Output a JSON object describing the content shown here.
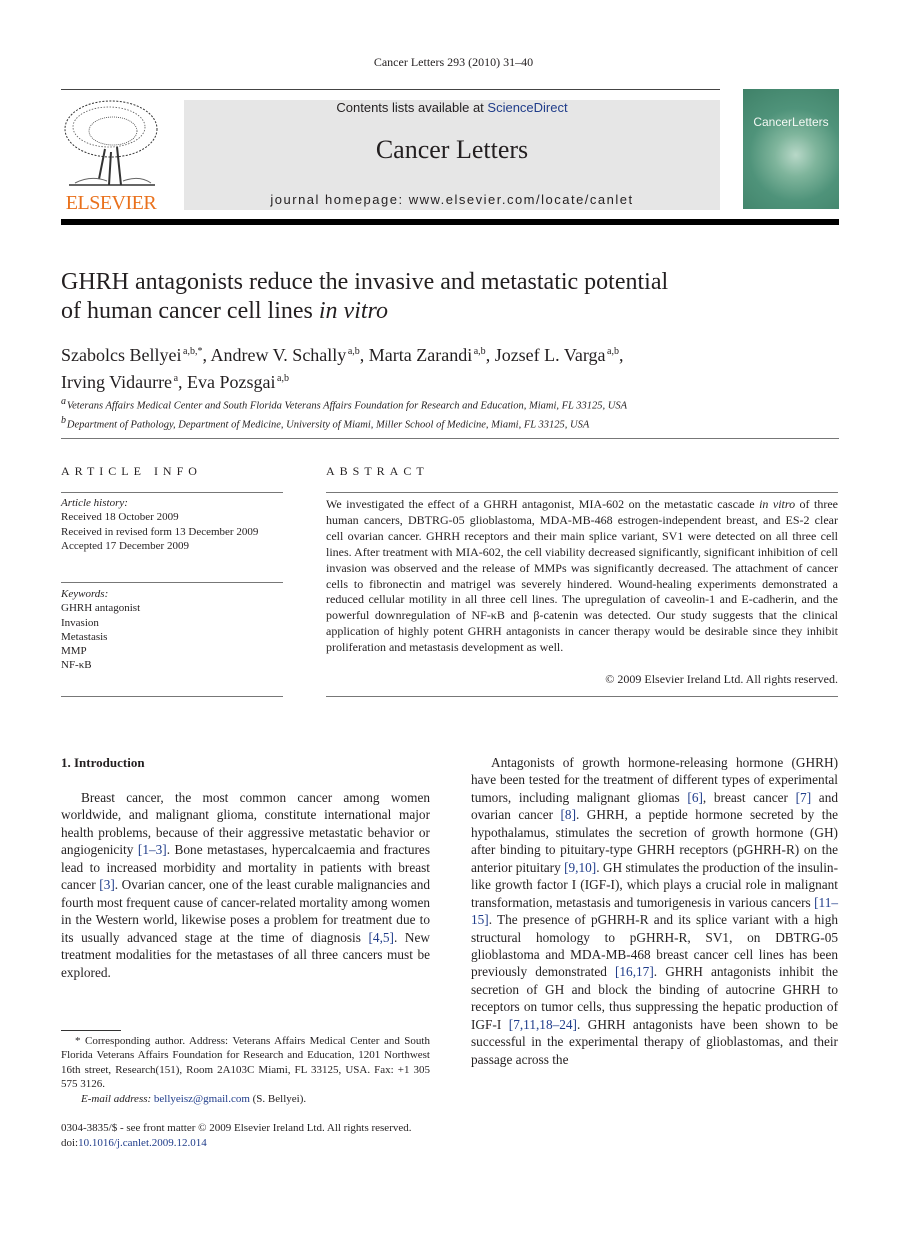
{
  "header": {
    "running_head": "Cancer Letters 293 (2010) 31–40",
    "contents_prefix": "Contents lists available at ",
    "contents_link": "ScienceDirect",
    "journal_name": "Cancer Letters",
    "homepage": "journal homepage: www.elsevier.com/locate/canlet",
    "publisher_logo_text": "ELSEVIER",
    "cover_title": "CancerLetters",
    "publisher_color": "#e9711c",
    "link_color": "#1f3c8a"
  },
  "article": {
    "title_line1": "GHRH antagonists reduce the invasive and metastatic potential",
    "title_line2_plain": "of human cancer cell lines ",
    "title_line2_italic": "in vitro",
    "authors": [
      {
        "name": "Szabolcs Bellyei",
        "aff": "a,b,*",
        "sep": ", "
      },
      {
        "name": "Andrew V. Schally",
        "aff": "a,b",
        "sep": ", "
      },
      {
        "name": "Marta Zarandi",
        "aff": "a,b",
        "sep": ", "
      },
      {
        "name": "Jozsef L. Varga",
        "aff": "a,b",
        "sep": ","
      },
      {
        "name": "Irving Vidaurre",
        "aff": "a",
        "sep": ", "
      },
      {
        "name": "Eva Pozsgai",
        "aff": "a,b",
        "sep": ""
      }
    ],
    "affiliations": [
      {
        "mark": "a",
        "text": "Veterans Affairs Medical Center and South Florida Veterans Affairs Foundation for Research and Education, Miami, FL 33125, USA"
      },
      {
        "mark": "b",
        "text": "Department of Pathology, Department of Medicine, University of Miami, Miller School of Medicine, Miami, FL 33125, USA"
      }
    ]
  },
  "article_info": {
    "heading": "ARTICLE INFO",
    "history_label": "Article history:",
    "history": [
      "Received 18 October 2009",
      "Received in revised form 13 December 2009",
      "Accepted 17 December 2009"
    ],
    "keywords_label": "Keywords:",
    "keywords": [
      "GHRH antagonist",
      "Invasion",
      "Metastasis",
      "MMP",
      "NF-κB"
    ]
  },
  "abstract": {
    "heading": "ABSTRACT",
    "part1": "We investigated the effect of a GHRH antagonist, MIA-602 on the metastatic cascade ",
    "italic": "in vitro",
    "part2": " of three human cancers, DBTRG-05 glioblastoma, MDA-MB-468 estrogen-independent breast, and ES-2 clear cell ovarian cancer. GHRH receptors and their main splice variant, SV1 were detected on all three cell lines. After treatment with MIA-602, the cell viability decreased significantly, significant inhibition of cell invasion was observed and the release of MMPs was significantly decreased. The attachment of cancer cells to fibronectin and matrigel was severely hindered. Wound-healing experiments demonstrated a reduced cellular motility in all three cell lines. The upregulation of caveolin-1 and E-cadherin, and the powerful downregulation of NF-κB and β-catenin was detected. Our study suggests that the clinical application of highly potent GHRH antagonists in cancer therapy would be desirable since they inhibit proliferation and metastasis development as well.",
    "copyright": "© 2009 Elsevier Ireland Ltd. All rights reserved."
  },
  "introduction": {
    "heading": "1.  Introduction",
    "col1": [
      {
        "t": "Breast cancer, the most common cancer among women worldwide, and malignant glioma, constitute international major health problems, because of their aggressive metastatic behavior or angiogenicity "
      },
      {
        "ref": "[1–3]"
      },
      {
        "t": ". Bone metastases, hypercalcaemia and fractures lead to increased morbidity and mortality in patients with breast cancer "
      },
      {
        "ref": "[3]"
      },
      {
        "t": ". Ovarian cancer, one of the least curable malignancies and fourth most frequent cause of cancer-related mortality among women in the Western world, likewise poses a problem for treatment due to its usually advanced stage at the time of diagnosis "
      },
      {
        "ref": "[4,5]"
      },
      {
        "t": ". New treatment modalities for the metastases of all three cancers must be explored."
      }
    ],
    "col2": [
      {
        "t": "Antagonists of growth hormone-releasing hormone (GHRH) have been tested for the treatment of different types of experimental tumors, including malignant gliomas "
      },
      {
        "ref": "[6]"
      },
      {
        "t": ", breast cancer "
      },
      {
        "ref": "[7]"
      },
      {
        "t": " and ovarian cancer "
      },
      {
        "ref": "[8]"
      },
      {
        "t": ". GHRH, a peptide hormone secreted by the hypothalamus, stimulates the secretion of growth hormone (GH) after binding to pituitary-type GHRH receptors (pGHRH-R) on the anterior pituitary "
      },
      {
        "ref": "[9,10]"
      },
      {
        "t": ". GH stimulates the production of the insulin-like growth factor I (IGF-I), which plays a crucial role in malignant transformation, metastasis and tumorigenesis in various cancers "
      },
      {
        "ref": "[11–15]"
      },
      {
        "t": ". The presence of pGHRH-R and its splice variant with a high structural homology to pGHRH-R, SV1, on DBTRG-05 glioblastoma and MDA-MB-468 breast cancer cell lines has been previously demonstrated "
      },
      {
        "ref": "[16,17]"
      },
      {
        "t": ". GHRH antagonists inhibit the secretion of GH and block the binding of autocrine GHRH to receptors on tumor cells, thus suppressing the hepatic production of IGF-I "
      },
      {
        "ref": "[7,11,18–24]"
      },
      {
        "t": ". GHRH antagonists have been shown to be successful in the experimental therapy of glioblastomas, and their passage across the"
      }
    ]
  },
  "footnote": {
    "corresponding": "* Corresponding author. Address: Veterans Affairs Medical Center and South Florida Veterans Affairs Foundation for Research and Education, 1201 Northwest 16th street, Research(151), Room 2A103C Miami, FL 33125, USA. Fax: +1 305 575 3126.",
    "email_label": "E-mail address: ",
    "email": "bellyeisz@gmail.com",
    "email_suffix": " (S. Bellyei)."
  },
  "front_matter": {
    "issn_line": "0304-3835/$ - see front matter © 2009 Elsevier Ireland Ltd. All rights reserved.",
    "doi_prefix": "doi:",
    "doi": "10.1016/j.canlet.2009.12.014"
  }
}
